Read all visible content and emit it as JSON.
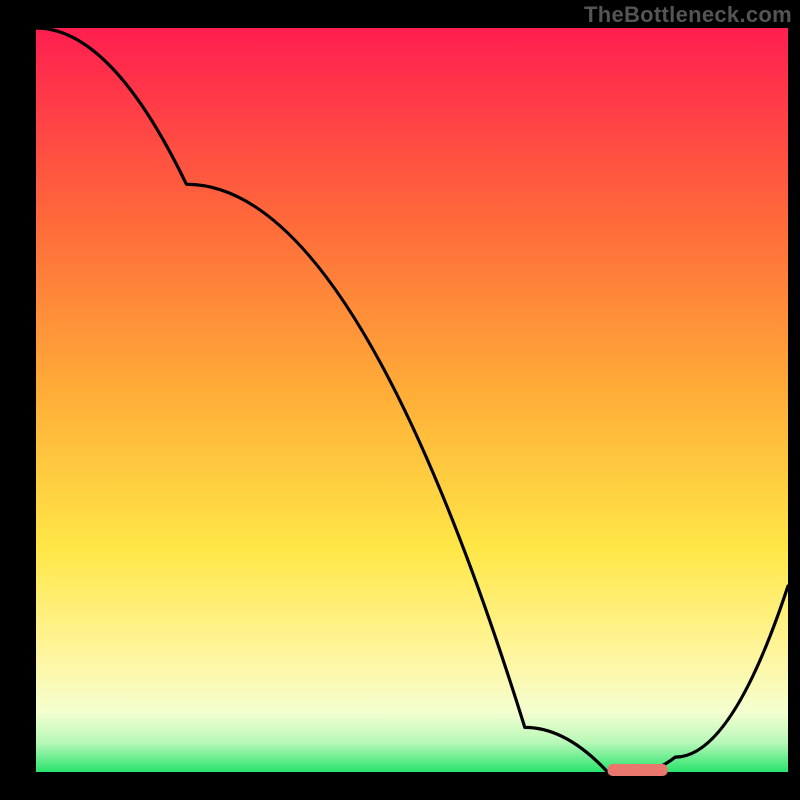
{
  "attribution": "TheBottleneck.com",
  "colors": {
    "bg_black": "#000000",
    "grad_top": "#ff1e50",
    "grad_mid_orange": "#ff8a2a",
    "grad_yellow": "#ffe747",
    "grad_lower_yellow": "#fff59c",
    "grad_pale": "#f4ffd0",
    "grad_green": "#28e46b",
    "curve": "#000000",
    "marker": "#e9776d"
  },
  "chart_data": {
    "type": "line",
    "title": "",
    "xlabel": "",
    "ylabel": "",
    "xlim": [
      0,
      100
    ],
    "ylim": [
      0,
      100
    ],
    "series": [
      {
        "name": "bottleneck-curve",
        "x": [
          0,
          20,
          65,
          76,
          80,
          85,
          100
        ],
        "values": [
          100,
          79,
          6,
          0,
          0,
          2,
          25
        ]
      }
    ],
    "marker": {
      "name": "optimal-range",
      "x_start": 76,
      "x_end": 84,
      "y": 0
    },
    "grid": false,
    "legend": false
  }
}
